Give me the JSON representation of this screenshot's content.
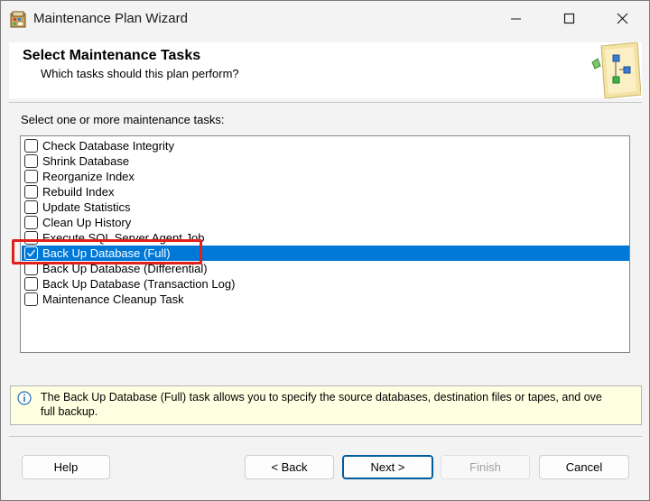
{
  "window": {
    "title": "Maintenance Plan Wizard",
    "controls": {
      "minimize": "minimize",
      "maximize": "maximize",
      "close": "close"
    }
  },
  "header": {
    "title": "Select Maintenance Tasks",
    "subtitle": "Which tasks should this plan perform?"
  },
  "main": {
    "prompt": "Select one or more maintenance tasks:",
    "tasks": [
      {
        "label": "Check Database Integrity",
        "checked": false
      },
      {
        "label": "Shrink Database",
        "checked": false
      },
      {
        "label": "Reorganize Index",
        "checked": false
      },
      {
        "label": "Rebuild Index",
        "checked": false
      },
      {
        "label": "Update Statistics",
        "checked": false
      },
      {
        "label": "Clean Up History",
        "checked": false
      },
      {
        "label": "Execute SQL Server Agent Job",
        "checked": false
      },
      {
        "label": "Back Up Database (Full)",
        "checked": true,
        "selected": true
      },
      {
        "label": "Back Up Database (Differential)",
        "checked": false
      },
      {
        "label": "Back Up Database (Transaction Log)",
        "checked": false
      },
      {
        "label": "Maintenance Cleanup Task",
        "checked": false
      }
    ]
  },
  "info": {
    "text_line1": "The Back Up Database (Full) task allows you to specify the source databases, destination files or tapes, and ove",
    "text_line2": "full backup."
  },
  "buttons": {
    "help": "Help",
    "back": "< Back",
    "next": "Next >",
    "finish": "Finish",
    "cancel": "Cancel"
  },
  "colors": {
    "selection": "#0078d7",
    "annotation": "#e0201b",
    "info_background": "#ffffe1"
  }
}
